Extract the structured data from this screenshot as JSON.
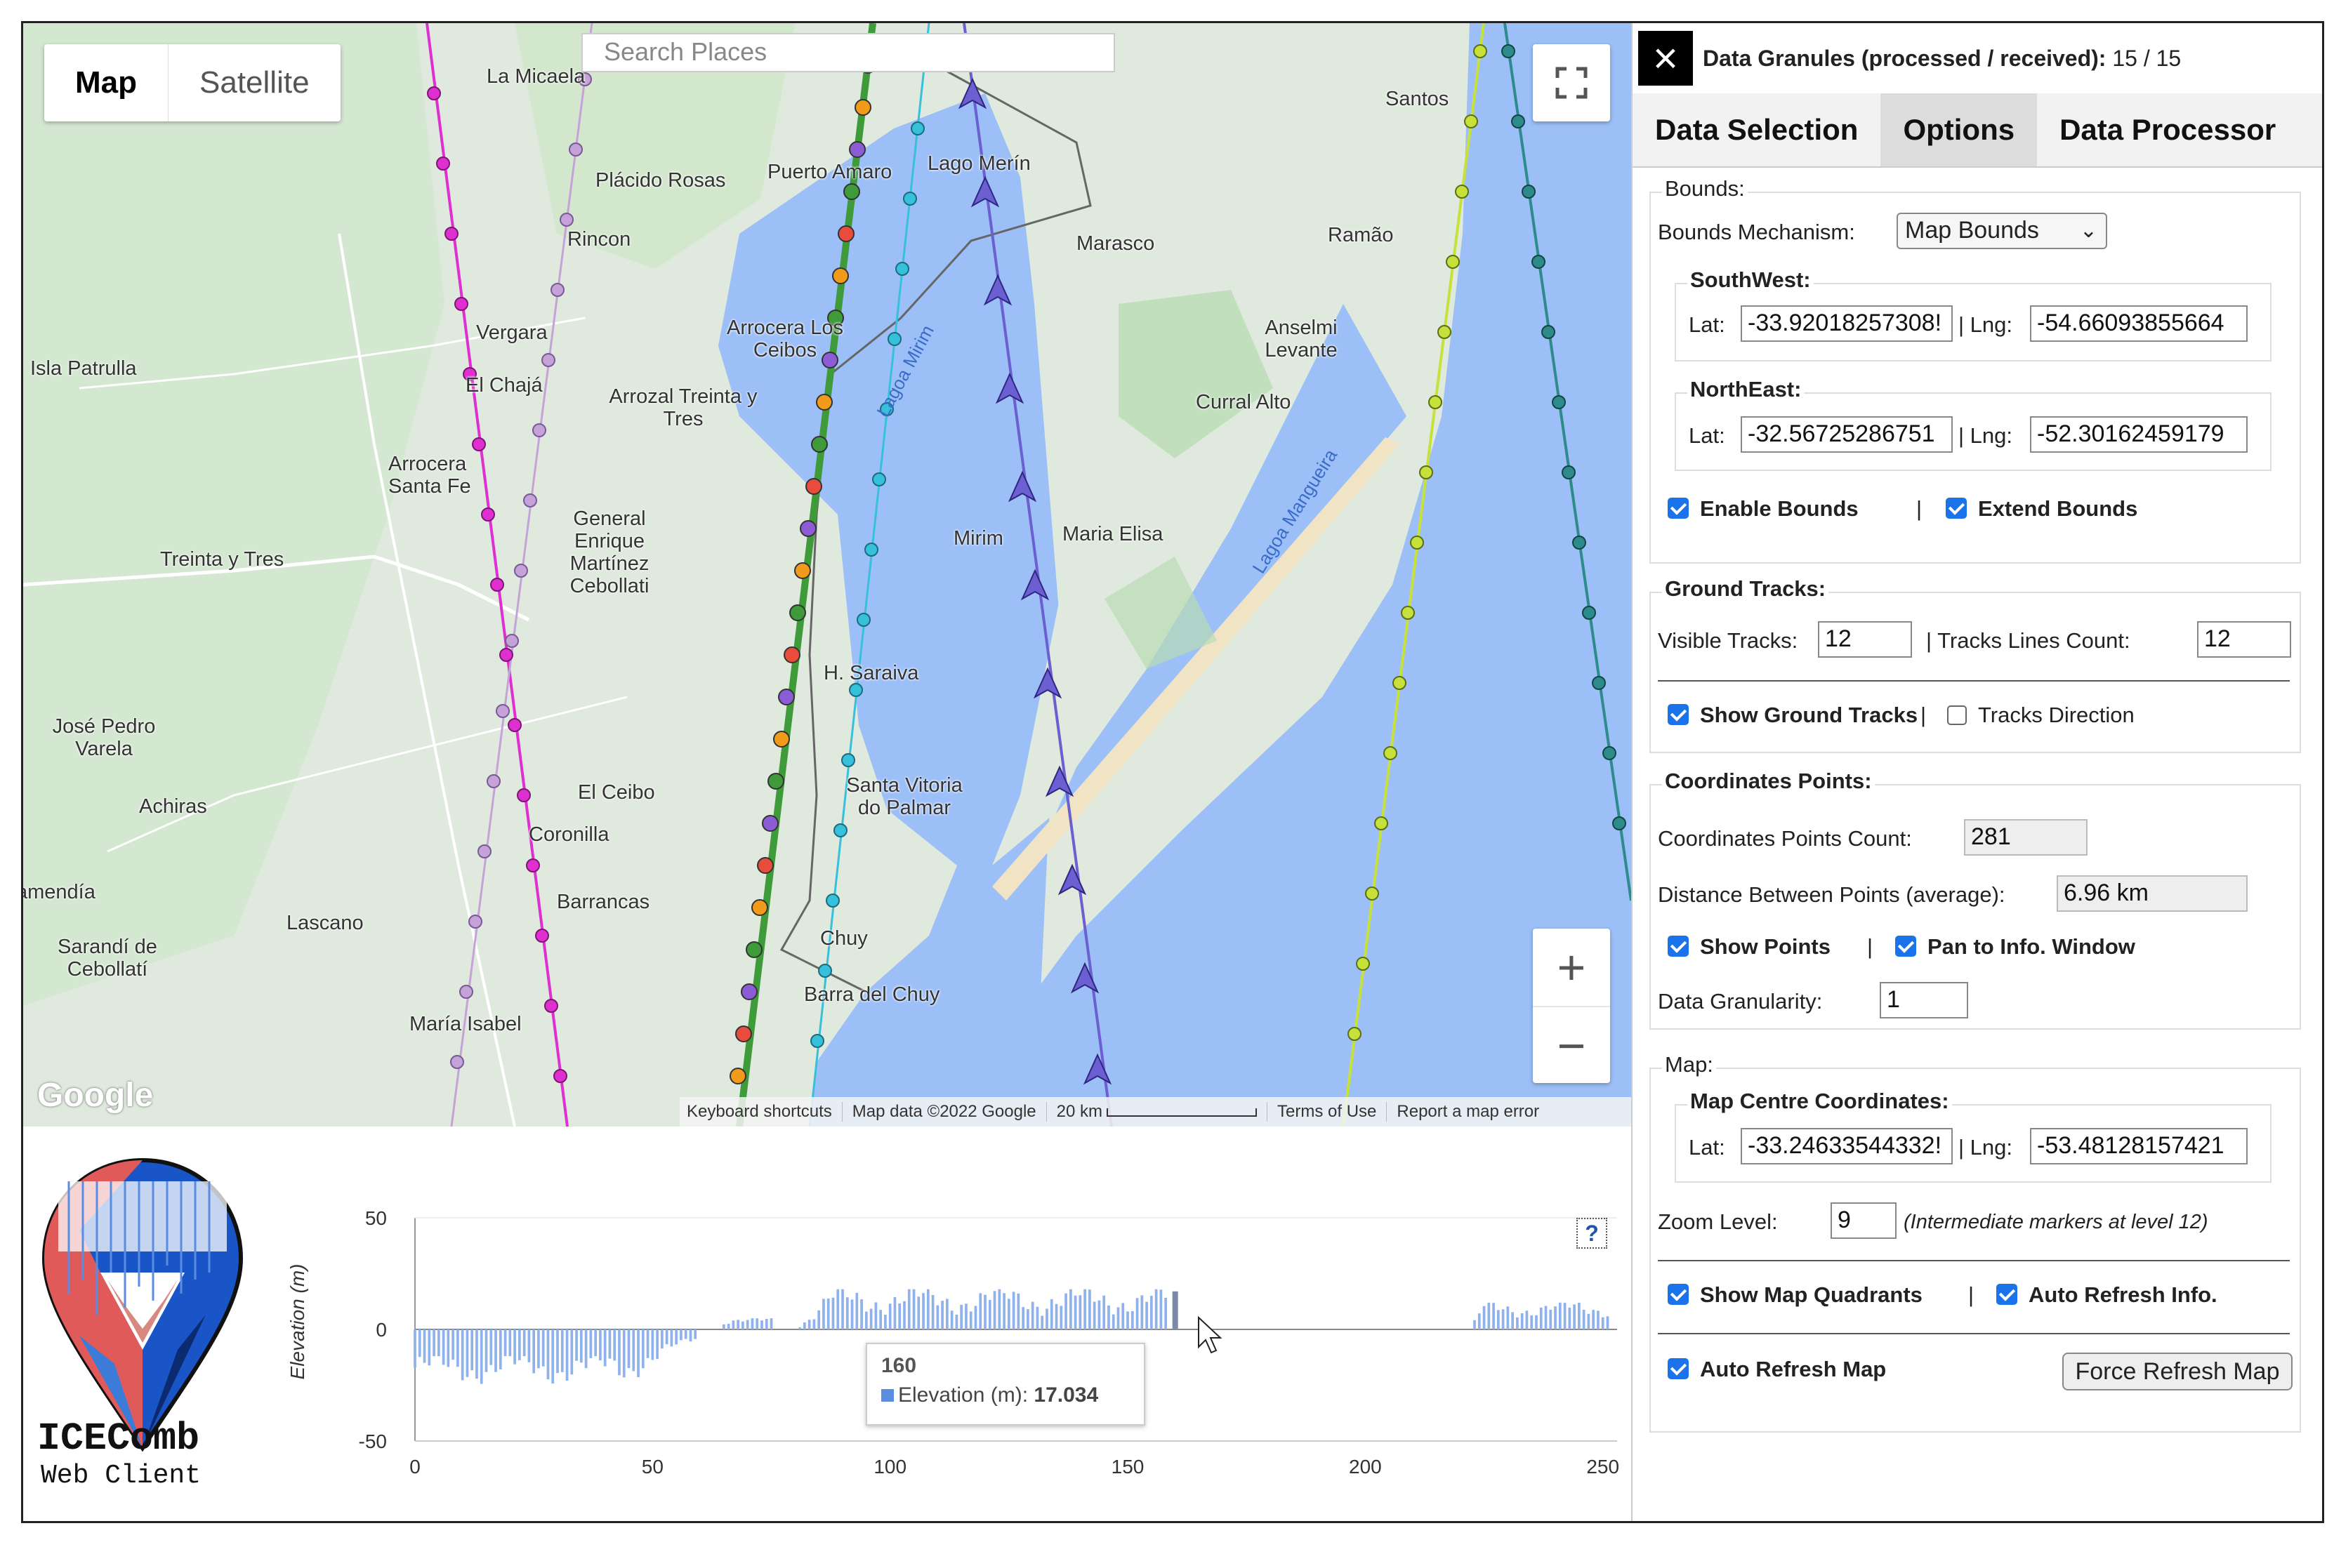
{
  "map": {
    "type_control": {
      "map": "Map",
      "satellite": "Satellite"
    },
    "search_placeholder": "Search Places",
    "zoom_in": "+",
    "zoom_out": "−",
    "google_logo": "Google",
    "attribution": {
      "keyboard": "Keyboard shortcuts",
      "data": "Map data ©2022 Google",
      "scale": "20 km",
      "terms": "Terms of Use",
      "report": "Report a map error"
    },
    "places": [
      "La Micaela",
      "Plácido Rosas",
      "Puerto Amaro",
      "Lago Merín",
      "Rincon",
      "Marasco",
      "Ramão",
      "Santos",
      "Isla Patrulla",
      "Vergara",
      "Arrocera Los Ceibos",
      "Anselmi Levante",
      "El Chajá",
      "Arrozal Treinta y Tres",
      "Curral Alto",
      "Arrocera Santa Fe",
      "General Enrique Martínez Cebollati",
      "Mirim",
      "Maria Elisa",
      "Treinta y Tres",
      "H. Saraiva",
      "José Pedro Varela",
      "El Ceibo",
      "Santa Vitoria do Palmar",
      "Achiras",
      "Coronilla",
      "Barrancas",
      "Lascano",
      "Chuy",
      "Sarandí de Cebollatí",
      "Barra del Chuy",
      "María Isabel",
      "Lagoa Mirim",
      "Lagoa Mangueira",
      "amendía"
    ],
    "colors": {
      "land": "#dfe9dd",
      "water": "#9cbff7",
      "green": "#b9dcb5",
      "sand": "#f1e4c4",
      "track_magenta": "#e02fd0",
      "track_pink": "#c5a3d9",
      "track_rainbow": "#3f9a3a",
      "track_cyan": "#37c0db",
      "track_purple": "#6b5fd1",
      "track_lime": "#c6e23a",
      "track_teal": "#2e8b8b"
    }
  },
  "panel": {
    "granules_label": "Data Granules (processed / received):",
    "granules_value": "15 / 15",
    "close_icon": "×",
    "tabs": [
      "Data Selection",
      "Options",
      "Data Processor"
    ],
    "active_tab": "Options",
    "bounds": {
      "legend": "Bounds:",
      "mechanism_label": "Bounds Mechanism:",
      "mechanism_value": "Map Bounds",
      "southwest": {
        "legend": "SouthWest:",
        "lat_label": "Lat:",
        "lat": "-33.92018257308!",
        "sep": "| Lng:",
        "lng": "-54.66093855664"
      },
      "northeast": {
        "legend": "NorthEast:",
        "lat_label": "Lat:",
        "lat": "-32.56725286751",
        "sep": "| Lng:",
        "lng": "-52.30162459179"
      },
      "enable": "Enable Bounds",
      "pipe": "|",
      "extend": "Extend Bounds"
    },
    "tracks": {
      "legend": "Ground Tracks:",
      "visible_label": "Visible Tracks:",
      "visible_value": "12",
      "lines_label": "| Tracks Lines Count:",
      "lines_value": "12",
      "show": "Show Ground Tracks",
      "pipe": "|",
      "direction": "Tracks Direction"
    },
    "points": {
      "legend": "Coordinates Points:",
      "count_label": "Coordinates Points Count:",
      "count_value": "281",
      "distance_label": "Distance Between Points (average):",
      "distance_value": "6.96 km",
      "show": "Show Points",
      "pipe": "|",
      "pan": "Pan to Info. Window",
      "granularity_label": "Data Granularity:",
      "granularity_value": "1"
    },
    "mapgrp": {
      "legend": "Map:",
      "centre_legend": "Map Centre Coordinates:",
      "lat_label": "Lat:",
      "lat": "-33.24633544332!",
      "sep": "| Lng:",
      "lng": "-53.48128157421",
      "zoom_label": "Zoom Level:",
      "zoom_value": "9",
      "zoom_note": "(Intermediate markers at level 12)",
      "quadrants": "Show Map Quadrants",
      "pipe": "|",
      "auto_info": "Auto Refresh Info.",
      "auto_map": "Auto Refresh Map",
      "force": "Force Refresh Map"
    }
  },
  "logo": {
    "title": "ICEComb",
    "subtitle": "Web Client"
  },
  "chart_data": {
    "type": "bar",
    "ylabel": "Elevation (m)",
    "xlabel": "",
    "xlim": [
      0,
      253
    ],
    "ylim": [
      -50,
      50
    ],
    "xticks": [
      "0",
      "50",
      "100",
      "150",
      "200",
      "250"
    ],
    "yticks": [
      "50",
      "0",
      "-50"
    ],
    "help": "?",
    "series": [
      {
        "name": "Elevation (m)",
        "segments": [
          {
            "x": [
              0,
              59
            ],
            "profile": "negative",
            "min": -25,
            "max": -12
          },
          {
            "x": [
              64,
              75
            ],
            "profile": "positive",
            "min": 2,
            "max": 5
          },
          {
            "x": [
              80,
              158
            ],
            "profile": "positive",
            "min": 6,
            "max": 18
          },
          {
            "x": [
              222,
              251
            ],
            "profile": "positive",
            "min": 5,
            "max": 12
          }
        ]
      }
    ],
    "tooltip": {
      "x": "160",
      "label": "Elevation (m):",
      "value": "17.034"
    }
  }
}
